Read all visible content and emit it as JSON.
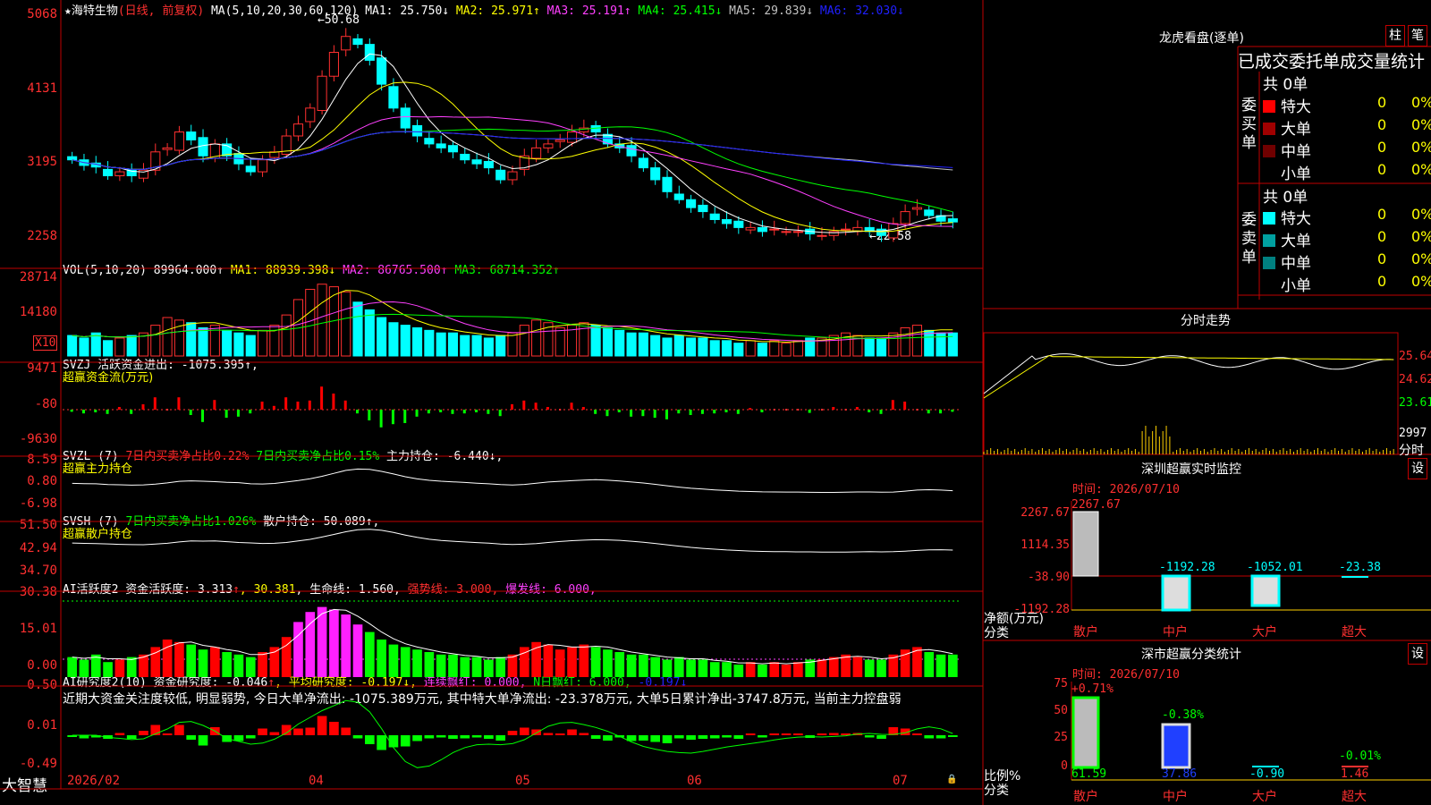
{
  "header": {
    "star": "★",
    "stock_name": "海特生物",
    "mode": "(日线, 前复权)",
    "ma_prefix": "MA(5,10,20,30,60,120)",
    "ma_items": [
      {
        "label": "MA1: 25.750↓",
        "color": "#ffffff"
      },
      {
        "label": "MA2: 25.971↑",
        "color": "#ffff00"
      },
      {
        "label": "MA3: 25.191↑",
        "color": "#ff40ff"
      },
      {
        "label": "MA4: 25.415↓",
        "color": "#00ff00"
      },
      {
        "label": "MA5: 29.839↓",
        "color": "#c0c0c0"
      },
      {
        "label": "MA6: 32.030↓",
        "color": "#2020ff"
      }
    ],
    "high_marker": "←50.68",
    "low_marker": "←22.58"
  },
  "price_axis": [
    "5068",
    "4131",
    "3195",
    "2258"
  ],
  "vol": {
    "title": "VOL(5,10,20)",
    "value": "89964.000↑",
    "ma": [
      {
        "label": "MA1: 88939.398↓",
        "color": "#ffff00"
      },
      {
        "label": "MA2: 86765.500↑",
        "color": "#ff40ff"
      },
      {
        "label": "MA3: 68714.352↑",
        "color": "#00ff00"
      }
    ],
    "axis": [
      "28714",
      "14180"
    ],
    "unit": "X10"
  },
  "svzj": {
    "line1": "SVZJ  活跃资金进出: -1075.395↑,",
    "line2": "超赢资金流(万元)",
    "axis": [
      "9471",
      "-80",
      "-9630"
    ]
  },
  "svzl": {
    "prefix": "SVZL (7) ",
    "red": "7日内买卖净占比0.22%",
    "green": " 7日内买卖净占比0.15%",
    "rest": " 主力持仓: -6.440↓,",
    "line2": "超赢主力持仓",
    "axis": [
      "8.59",
      "0.80",
      "-6.98"
    ]
  },
  "svsh": {
    "prefix": "SVSH (7) ",
    "green": "7日内买卖净占比1.026%",
    "rest": " 散户持仓: 50.089↑,",
    "line2": "超赢散户持仓",
    "axis": [
      "51.50",
      "42.94",
      "34.70"
    ]
  },
  "ai1": {
    "items": [
      {
        "t": "AI活跃度2 资金活跃度: 3.313",
        "c": "#ffffff"
      },
      {
        "t": "↑",
        "c": "#ff3030"
      },
      {
        "t": ", 30.381",
        "c": "#ffff00"
      },
      {
        "t": ", 生命线: 1.560,",
        "c": "#ffffff"
      },
      {
        "t": " 强势线: 3.000,",
        "c": "#ff3030"
      },
      {
        "t": " 爆发线: 6.000,",
        "c": "#ff40ff"
      }
    ],
    "axis": [
      "30.38",
      "15.01",
      "0.00"
    ]
  },
  "ai2": {
    "items": [
      {
        "t": "AI研究度2(10) 资金研究度: -0.046",
        "c": "#ffffff"
      },
      {
        "t": "↑",
        "c": "#ff3030"
      },
      {
        "t": ", 平均研究度: -0.197↓,",
        "c": "#ffff00"
      },
      {
        "t": " 连续飘红: 0.000,",
        "c": "#ff40ff"
      },
      {
        "t": " N日飘红: 6.000,",
        "c": "#00ff00"
      },
      {
        "t": " -0.197↓",
        "c": "#2020ff"
      }
    ],
    "summary": "近期大资金关注度较低, 明显弱势, 今日大单净流出: -1075.389万元, 其中特大单净流出: -23.378万元, 大单5日累计净出-3747.8万元, 当前主力控盘弱",
    "axis": [
      "0.50",
      "0.01",
      "-0.49"
    ]
  },
  "date_axis": {
    "brand": "大智慧",
    "labels": [
      "2026/02",
      "04",
      "05",
      "06",
      "07"
    ],
    "lock": "🔒"
  },
  "lhb": {
    "title": "龙虎看盘(逐单)",
    "btn1": "柱",
    "btn2": "笔",
    "header": "已成交委托单成交量统计",
    "buy": {
      "side": "委买单",
      "total": "共 0单",
      "rows": [
        {
          "name": "特大",
          "n": "0",
          "p": "0%",
          "color": "#ff0000"
        },
        {
          "name": "大单",
          "n": "0",
          "p": "0%",
          "color": "#a00000"
        },
        {
          "name": "中单",
          "n": "0",
          "p": "0%",
          "color": "#700000"
        },
        {
          "name": "小单",
          "n": "0",
          "p": "0%",
          "color": ""
        }
      ]
    },
    "sell": {
      "side": "委卖单",
      "total": "共 0单",
      "rows": [
        {
          "name": "特大",
          "n": "0",
          "p": "0%",
          "color": "#00ffff"
        },
        {
          "name": "大单",
          "n": "0",
          "p": "0%",
          "color": "#00a0a0"
        },
        {
          "name": "中单",
          "n": "0",
          "p": "0%",
          "color": "#008080"
        },
        {
          "name": "小单",
          "n": "0",
          "p": "0%",
          "color": ""
        }
      ]
    }
  },
  "intraday": {
    "title": "分时走势",
    "axis": [
      "25.64",
      "24.62",
      "23.61",
      "2997"
    ],
    "unit": "分时"
  },
  "sz_monitor": {
    "title": "深圳超赢实时监控",
    "btn": "设",
    "time": "时间: 2026/07/10",
    "axis": [
      "2267.67",
      "1114.35",
      "-38.90",
      "-1192.28"
    ],
    "ylabel": "净额(万元)",
    "xlabel": "分类",
    "bars": [
      {
        "cat": "散户",
        "label": "2267.67"
      },
      {
        "cat": "中户",
        "label": "-1192.28"
      },
      {
        "cat": "大户",
        "label": "-1052.01"
      },
      {
        "cat": "超大",
        "label": "-23.38"
      }
    ]
  },
  "sz_stats": {
    "title": "深市超赢分类统计",
    "btn": "设",
    "time": "时间: 2026/07/10",
    "axis": [
      "75",
      "50",
      "25",
      "0"
    ],
    "ylabel": "比例%",
    "xlabel": "分类",
    "bars": [
      {
        "cat": "散户",
        "top": "+0.71%",
        "bottom": "61.59"
      },
      {
        "cat": "中户",
        "top": "-0.38%",
        "bottom": "37.86"
      },
      {
        "cat": "大户",
        "top": "",
        "bottom": "-0.90"
      },
      {
        "cat": "超大",
        "top": "-0.01%",
        "bottom": "1.46"
      }
    ]
  },
  "chart_data": {
    "type": "candlestick",
    "title": "海特生物 日线 前复权",
    "price_range": [
      22.58,
      50.68
    ],
    "close_approx": [
      33.5,
      32.8,
      32.6,
      31.5,
      32.0,
      31.5,
      32.2,
      34.5,
      35.0,
      37.0,
      36.0,
      34.0,
      35.5,
      34.0,
      33.0,
      32.0,
      33.5,
      34.5,
      36.5,
      38.0,
      40.0,
      44.0,
      47.0,
      49.0,
      48.0,
      46.0,
      43.0,
      40.0,
      37.5,
      36.5,
      35.5,
      35.0,
      34.5,
      33.5,
      33.0,
      32.5,
      31.0,
      32.0,
      34.0,
      35.0,
      35.5,
      36.0,
      37.0,
      37.5,
      37.0,
      35.5,
      35.0,
      34.0,
      32.5,
      31.0,
      29.5,
      28.5,
      27.5,
      27.0,
      26.0,
      25.5,
      25.0,
      25.0,
      24.5,
      24.8,
      24.5,
      24.5,
      24.2,
      24.0,
      24.5,
      24.8,
      25.0,
      24.5,
      24.0,
      25.5,
      27.0,
      27.5,
      26.5,
      25.8,
      25.7
    ],
    "volume_approx": [
      8,
      7,
      9,
      6,
      7,
      8,
      9,
      12,
      15,
      14,
      13,
      11,
      12,
      10,
      9,
      8,
      10,
      12,
      16,
      22,
      26,
      28,
      27,
      25,
      21,
      18,
      15,
      13,
      12,
      11,
      10,
      9,
      9,
      8,
      8,
      7,
      8,
      9,
      12,
      14,
      13,
      11,
      12,
      13,
      12,
      11,
      10,
      9,
      9,
      8,
      7,
      8,
      7,
      7,
      6,
      6,
      5,
      6,
      5,
      6,
      5,
      6,
      7,
      7,
      8,
      9,
      8,
      7,
      7,
      9,
      11,
      12,
      10,
      9,
      9
    ],
    "x_ticks": [
      "2026/02",
      "04",
      "05",
      "06",
      "07"
    ]
  }
}
